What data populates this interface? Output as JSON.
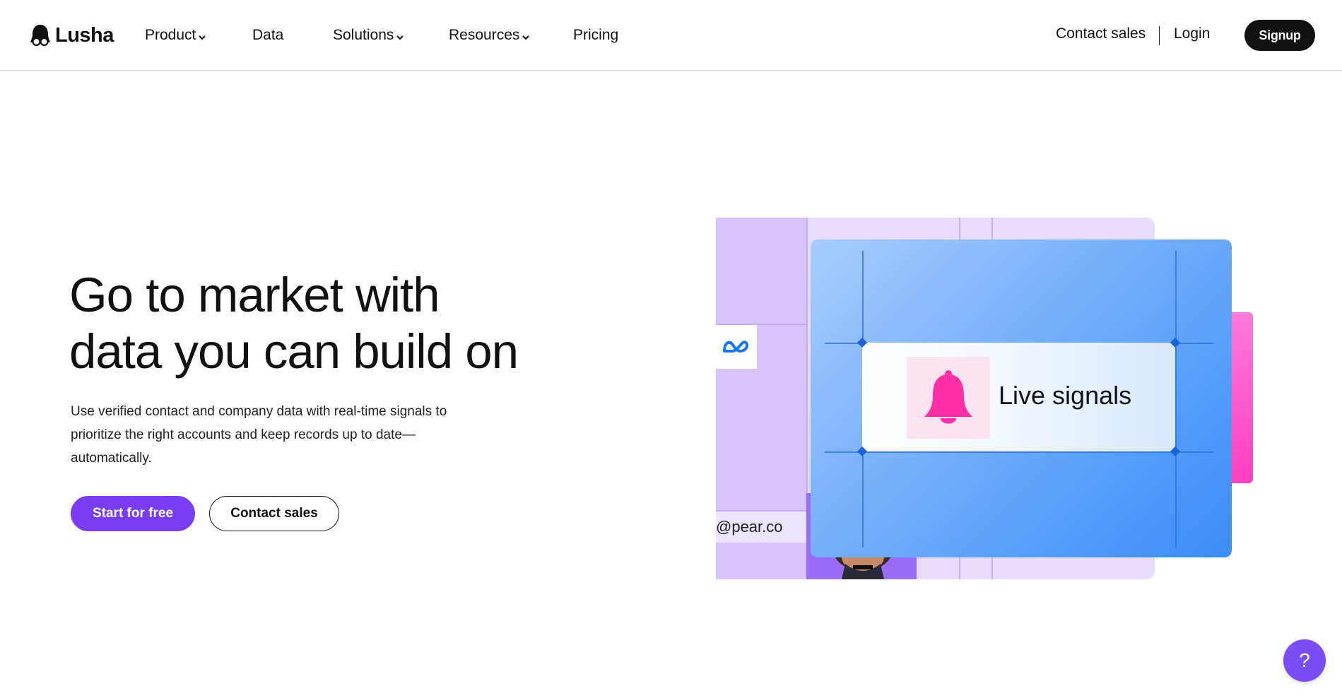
{
  "brand": {
    "name": "Lusha",
    "accent_color": "#7a3cf0"
  },
  "nav": {
    "items": [
      {
        "label": "Product",
        "has_dropdown": true
      },
      {
        "label": "Data",
        "has_dropdown": false
      },
      {
        "label": "Solutions",
        "has_dropdown": true
      },
      {
        "label": "Resources",
        "has_dropdown": true
      },
      {
        "label": "Pricing",
        "has_dropdown": false
      }
    ],
    "contact_sales": "Contact sales",
    "login": "Login",
    "signup": "Signup"
  },
  "hero": {
    "title_line1": "Go to market with",
    "title_line2": "data you can build on",
    "subtitle": "Use verified contact and company data with real-time signals to prioritize the right accounts and keep records up to date—automatically.",
    "primary_cta": "Start for free",
    "secondary_cta": "Contact sales"
  },
  "illustration": {
    "signal_label": "Live signals",
    "email_text": "@pear.co",
    "icons": [
      "bell-icon",
      "meta-logo-icon"
    ],
    "colors": {
      "blue_card": "#74aefb",
      "pink_card": "#ff4fc8",
      "purple_panel": "#d8c3fb",
      "bell": "#ff2fa6"
    }
  },
  "help": {
    "label": "?",
    "icon": "help-icon"
  }
}
